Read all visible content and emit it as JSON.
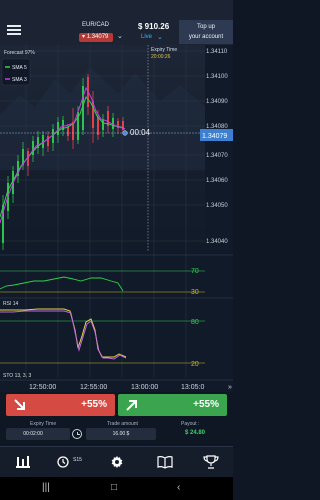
{
  "header": {
    "pair": "EUR/CAD",
    "pair_rate": "1.34079",
    "balance": "$ 910.26",
    "account_mode": "Live",
    "topup_line1": "Top up",
    "topup_line2": "your account"
  },
  "chart": {
    "forecast_label": "Forecast 97%",
    "sma_legend": [
      {
        "name": "SMA 5",
        "color": "#2fd14e"
      },
      {
        "name": "SMA 3",
        "color": "#c93be0"
      }
    ],
    "expiry_label": "Expiry Time",
    "expiry_time": "20:00:26",
    "countdown": "00:04",
    "current_price": "1.34079",
    "price_ticks": [
      "1.34110",
      "1.34100",
      "1.34090",
      "1.34080",
      "1.34070",
      "1.34060",
      "1.34050",
      "1.34040"
    ],
    "time_ticks": [
      "12:50:00",
      "12:55:00",
      "13:00:00",
      "13:05:0"
    ],
    "rsi_label": "RSI 14",
    "rsi_levels": [
      "70",
      "30"
    ],
    "sto_label": "STO 13, 3, 3",
    "sto_levels": [
      "80",
      "20"
    ],
    "colors": {
      "up": "#2fc24f",
      "down": "#e2414a",
      "price_tag": "#3d7fd0",
      "rsi_line": "#2fd14e",
      "level_line": "#c9b923",
      "sto_k": "#e6d64b",
      "sto_d": "#c16ae0"
    }
  },
  "trade": {
    "down_payout": "+55%",
    "up_payout": "+55%",
    "expiry_label": "Expiry Time",
    "expiry_value": "00:02:00",
    "amount_label": "Trade amount",
    "amount_value": "16.00 $",
    "payout_label": "Payout :",
    "payout_value": "$ 24.80"
  },
  "nav": {
    "timeframe": "S15",
    "items": [
      "chart-type-icon",
      "timeframe-icon",
      "settings-gear-icon",
      "book-icon",
      "trophy-icon"
    ]
  },
  "system_nav": [
    "recent-apps-icon",
    "home-icon",
    "back-icon"
  ]
}
